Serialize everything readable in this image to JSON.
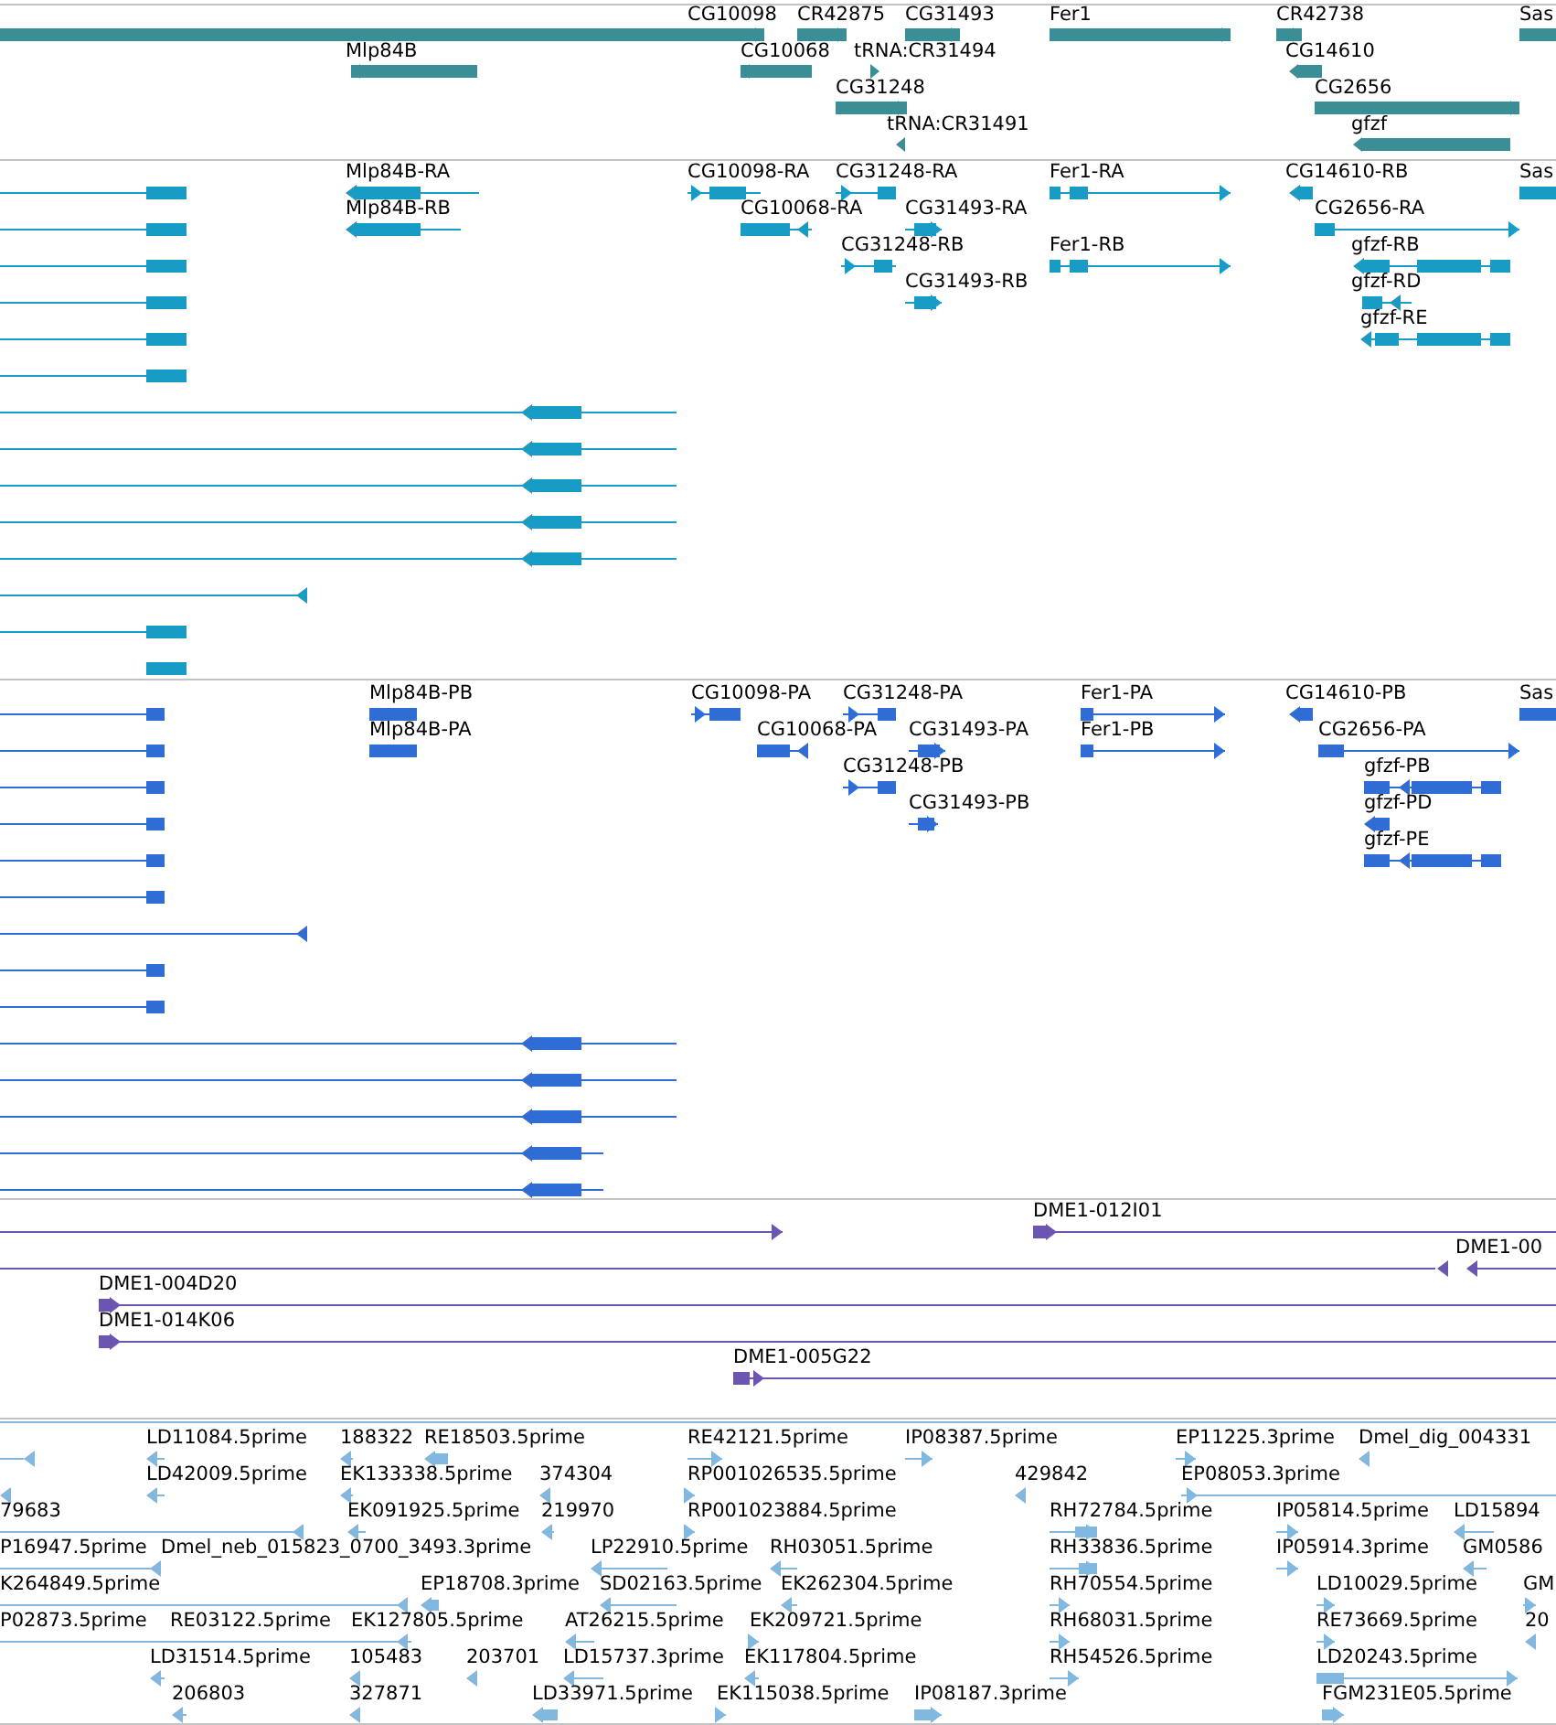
{
  "tracks": [
    {
      "color": "#3a8e96",
      "features": [
        {
          "kind": "plain"
        },
        {
          "label": "CG10098",
          "kind": "forward"
        },
        {
          "label": "CR42875",
          "kind": "forward"
        },
        {
          "label": "CG31493",
          "kind": "forward"
        },
        {
          "label": "Fer1",
          "kind": "forward"
        },
        {
          "label": "CR42738",
          "kind": "forward"
        },
        {
          "label": "Sas",
          "kind": "plain"
        },
        {
          "label": "Mlp84B",
          "kind": "reverse"
        },
        {
          "label": "CG10068",
          "kind": "reverse"
        },
        {
          "label": "tRNA:CR31494",
          "kind": "forward"
        },
        {
          "label": "CG14610",
          "kind": "reverse"
        },
        {
          "label": "CG31248",
          "kind": "forward"
        },
        {
          "label": "CG2656",
          "kind": "forward"
        },
        {
          "label": "tRNA:CR31491",
          "kind": "reverse"
        },
        {
          "label": "gfzf",
          "kind": "reverse"
        }
      ]
    },
    {
      "color": "#189cc6",
      "features": [
        {
          "kind": "plain"
        },
        {
          "kind": "plain"
        },
        {
          "kind": "plain"
        },
        {
          "kind": "plain"
        },
        {
          "kind": "plain"
        },
        {
          "kind": "plain"
        },
        {
          "kind": "reverse"
        },
        {
          "kind": "reverse"
        },
        {
          "kind": "reverse"
        },
        {
          "kind": "reverse"
        },
        {
          "kind": "reverse"
        },
        {
          "kind": "reverse"
        },
        {
          "kind": "plain"
        },
        {
          "kind": "plain"
        },
        {
          "label": "Mlp84B-RA",
          "kind": "reverse"
        },
        {
          "label": "Mlp84B-RB",
          "kind": "reverse"
        },
        {
          "label": "CG10098-RA",
          "kind": "forward"
        },
        {
          "label": "CG31248-RA",
          "kind": "forward"
        },
        {
          "label": "CG10068-RA",
          "kind": "reverse"
        },
        {
          "label": "CG31493-RA",
          "kind": "forward"
        },
        {
          "label": "CG31248-RB",
          "kind": "forward"
        },
        {
          "label": "CG31493-RB",
          "kind": "forward"
        },
        {
          "label": "Fer1-RA",
          "kind": "forward"
        },
        {
          "label": "Fer1-RB",
          "kind": "forward"
        },
        {
          "label": "CG14610-RB",
          "kind": "reverse"
        },
        {
          "label": "Sas",
          "kind": "plain"
        },
        {
          "label": "CG2656-RA",
          "kind": "forward"
        },
        {
          "label": "gfzf-RB",
          "kind": "reverse"
        },
        {
          "label": "gfzf-RD",
          "kind": "reverse"
        },
        {
          "label": "gfzf-RE",
          "kind": "reverse"
        }
      ]
    },
    {
      "color": "#2f6cd4",
      "features": [
        {
          "kind": "plain"
        },
        {
          "kind": "plain"
        },
        {
          "kind": "plain"
        },
        {
          "kind": "plain"
        },
        {
          "kind": "plain"
        },
        {
          "kind": "plain"
        },
        {
          "kind": "reverse"
        },
        {
          "kind": "plain"
        },
        {
          "kind": "plain"
        },
        {
          "kind": "reverse"
        },
        {
          "kind": "reverse"
        },
        {
          "kind": "reverse"
        },
        {
          "kind": "reverse"
        },
        {
          "kind": "reverse"
        },
        {
          "label": "Mlp84B-PB",
          "kind": "plain"
        },
        {
          "label": "Mlp84B-PA",
          "kind": "plain"
        },
        {
          "label": "CG10098-PA",
          "kind": "forward"
        },
        {
          "label": "CG31248-PA",
          "kind": "forward"
        },
        {
          "label": "CG10068-PA",
          "kind": "reverse"
        },
        {
          "label": "CG31493-PA",
          "kind": "forward"
        },
        {
          "label": "CG31248-PB",
          "kind": "forward"
        },
        {
          "label": "CG31493-PB",
          "kind": "forward"
        },
        {
          "label": "Fer1-PA",
          "kind": "forward"
        },
        {
          "label": "Fer1-PB",
          "kind": "forward"
        },
        {
          "label": "CG14610-PB",
          "kind": "reverse"
        },
        {
          "label": "Sas",
          "kind": "plain"
        },
        {
          "label": "CG2656-PA",
          "kind": "forward"
        },
        {
          "label": "gfzf-PB",
          "kind": "reverse"
        },
        {
          "label": "gfzf-PD",
          "kind": "reverse"
        },
        {
          "label": "gfzf-PE",
          "kind": "reverse"
        }
      ]
    },
    {
      "color": "#6b55b0",
      "features": [
        {
          "kind": "forward"
        },
        {
          "label": "DME1-012I01",
          "kind": "forward"
        },
        {
          "kind": "reverse"
        },
        {
          "label": "DME1-00",
          "kind": "reverse"
        },
        {
          "label": "DME1-004D20",
          "kind": "forward"
        },
        {
          "label": "DME1-014K06",
          "kind": "forward"
        },
        {
          "label": "DME1-005G22",
          "kind": "forward"
        }
      ]
    },
    {
      "color": "#80b8e0",
      "features": [
        {
          "kind": "plain"
        },
        {
          "kind": "reverse"
        },
        {
          "label": "LD11084.5prime",
          "kind": "reverse"
        },
        {
          "label": "188322",
          "kind": "reverse"
        },
        {
          "label": "RE18503.5prime",
          "kind": "reverse"
        },
        {
          "label": "RE42121.5prime",
          "kind": "forward"
        },
        {
          "label": "IP08387.5prime",
          "kind": "forward"
        },
        {
          "label": "EP11225.3prime",
          "kind": "forward"
        },
        {
          "label": "Dmel_dig_004331",
          "kind": "reverse"
        },
        {
          "kind": "reverse"
        },
        {
          "label": "LD42009.5prime",
          "kind": "reverse"
        },
        {
          "label": "EK133338.5prime",
          "kind": "reverse"
        },
        {
          "label": "374304",
          "kind": "reverse"
        },
        {
          "label": "RP001026535.5prime",
          "kind": "forward"
        },
        {
          "label": "429842",
          "kind": "reverse"
        },
        {
          "label": "EP08053.3prime",
          "kind": "forward"
        },
        {
          "label": "79683",
          "kind": "reverse"
        },
        {
          "label": "EK091925.5prime",
          "kind": "reverse"
        },
        {
          "label": "219970",
          "kind": "reverse"
        },
        {
          "label": "RP001023884.5prime",
          "kind": "forward"
        },
        {
          "label": "RH72784.5prime",
          "kind": "forward"
        },
        {
          "label": "IP05814.5prime",
          "kind": "forward"
        },
        {
          "label": "LD15894",
          "kind": "reverse"
        },
        {
          "label": "P16947.5prime",
          "kind": "reverse"
        },
        {
          "label": "Dmel_neb_015823_0700_3493.3prime",
          "kind": "label"
        },
        {
          "label": "LP22910.5prime",
          "kind": "reverse"
        },
        {
          "label": "RH03051.5prime",
          "kind": "reverse"
        },
        {
          "label": "RH33836.5prime",
          "kind": "forward"
        },
        {
          "label": "IP05914.3prime",
          "kind": "forward"
        },
        {
          "label": "GM0586",
          "kind": "reverse"
        },
        {
          "label": "K264849.5prime",
          "kind": "reverse"
        },
        {
          "label": "EP18708.3prime",
          "kind": "reverse"
        },
        {
          "label": "SD02163.5prime",
          "kind": "reverse"
        },
        {
          "label": "EK262304.5prime",
          "kind": "reverse"
        },
        {
          "label": "RH70554.5prime",
          "kind": "forward"
        },
        {
          "label": "LD10029.5prime",
          "kind": "forward"
        },
        {
          "label": "GM",
          "kind": "forward"
        },
        {
          "label": "P02873.5prime",
          "kind": "reverse"
        },
        {
          "label": "RE03122.5prime",
          "kind": "label"
        },
        {
          "label": "EK127805.5prime",
          "kind": "label"
        },
        {
          "label": "AT26215.5prime",
          "kind": "reverse"
        },
        {
          "label": "EK209721.5prime",
          "kind": "forward"
        },
        {
          "label": "RH68031.5prime",
          "kind": "forward"
        },
        {
          "label": "RE73669.5prime",
          "kind": "forward"
        },
        {
          "label": "20",
          "kind": "reverse"
        },
        {
          "label": "LD31514.5prime",
          "kind": "reverse"
        },
        {
          "label": "105483",
          "kind": "reverse"
        },
        {
          "label": "203701",
          "kind": "reverse"
        },
        {
          "label": "LD15737.3prime",
          "kind": "reverse"
        },
        {
          "label": "EK117804.5prime",
          "kind": "reverse"
        },
        {
          "label": "RH54526.5prime",
          "kind": "forward"
        },
        {
          "label": "LD20243.5prime",
          "kind": "forward"
        },
        {
          "label": "206803",
          "kind": "reverse"
        },
        {
          "label": "327871",
          "kind": "reverse"
        },
        {
          "label": "LD33971.5prime",
          "kind": "reverse"
        },
        {
          "label": "EK115038.5prime",
          "kind": "forward"
        },
        {
          "label": "IP08187.3prime",
          "kind": "forward"
        },
        {
          "label": "FGM231E05.5prime",
          "kind": "forward"
        }
      ]
    }
  ]
}
